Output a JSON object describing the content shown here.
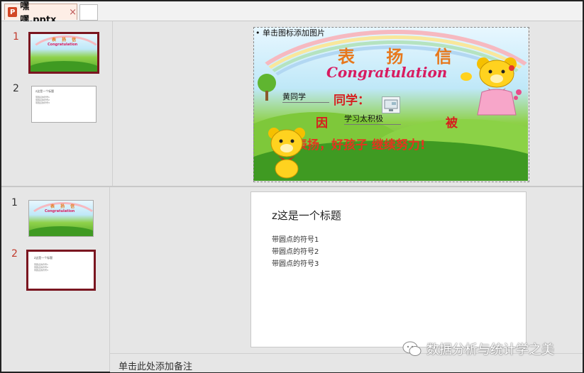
{
  "tab": {
    "label": "嘿嘿.pptx",
    "close": "×",
    "icon": "P"
  },
  "top_pane": {
    "slide_numbers": [
      "1",
      "2"
    ],
    "placeholder_hint": "单击图标添加图片"
  },
  "certificate": {
    "title": "表 扬 信",
    "subtitle": "Congratulation",
    "name_value": "黄同学",
    "classmate": "同学：",
    "because": "因",
    "reason_value": "学习太积极",
    "praised": "被",
    "slogan": "表扬，好孩子 继续努力!"
  },
  "mini_slide2": {
    "title": "z这是一个标题",
    "lines": [
      "带圆点的符号1",
      "带圆点的符号2",
      "带圆点的符号3"
    ]
  },
  "mini_slide1": {
    "title": "表 扬 信",
    "subtitle": "Congratulation",
    "classmate": "同学"
  },
  "bottom_pane": {
    "slide_numbers": [
      "1",
      "2"
    ],
    "slide2": {
      "title": "z这是一个标题",
      "lines": [
        "带圆点的符号1",
        "带圆点的符号2",
        "带圆点的符号3"
      ]
    },
    "notes_placeholder": "单击此处添加备注"
  },
  "watermark": {
    "text": "数据分析与统计学之美"
  },
  "colors": {
    "accent": "#7a1620",
    "active_number": "#c0392b",
    "tab_bg": "#fdeee6"
  }
}
